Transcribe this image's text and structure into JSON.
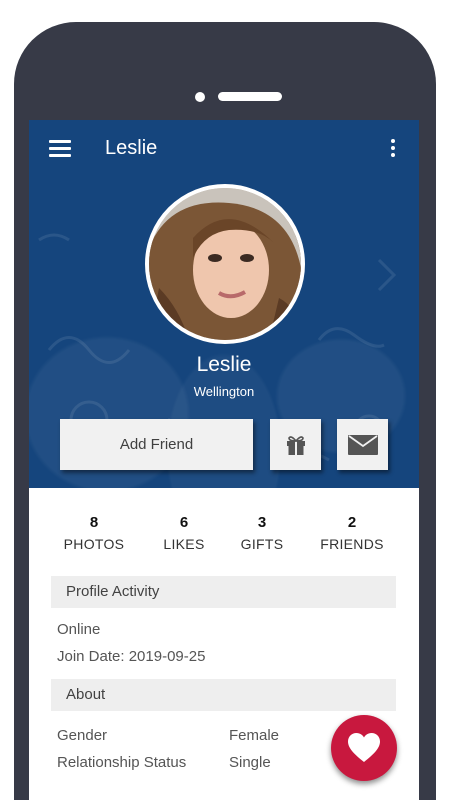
{
  "appbar": {
    "title": "Leslie"
  },
  "profile": {
    "name": "Leslie",
    "location": "Wellington"
  },
  "actions": {
    "add_friend_label": "Add Friend"
  },
  "stats": [
    {
      "value": "8",
      "label": "PHOTOS"
    },
    {
      "value": "6",
      "label": "LIKES"
    },
    {
      "value": "3",
      "label": "GIFTS"
    },
    {
      "value": "2",
      "label": "FRIENDS"
    }
  ],
  "activity": {
    "title": "Profile Activity",
    "status": "Online",
    "join_date": "Join Date: 2019-09-25"
  },
  "about": {
    "title": "About",
    "rows": [
      {
        "label": "Gender",
        "value": "Female"
      },
      {
        "label": "Relationship Status",
        "value": "Single"
      }
    ]
  },
  "icons": {
    "menu": "menu-icon",
    "more": "more-vert-icon",
    "gift": "gift-icon",
    "mail": "mail-icon",
    "heart": "heart-icon"
  },
  "colors": {
    "header": "#15457d",
    "fab": "#c8183e",
    "frame": "#373a47"
  }
}
